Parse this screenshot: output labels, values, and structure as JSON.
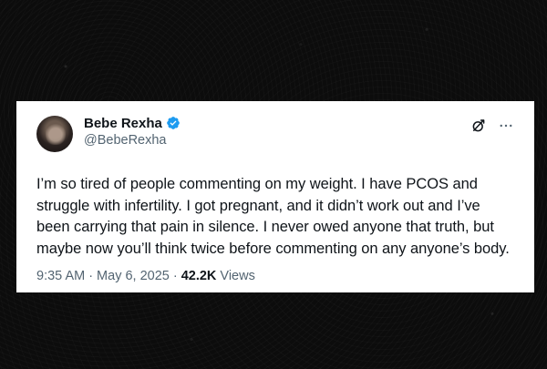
{
  "tweet": {
    "author": {
      "display_name": "Bebe Rexha",
      "handle": "@BebeRexha",
      "verified": true
    },
    "text": "I’m so tired of people commenting on my weight. I have PCOS and\nstruggle with infertility. I got pregnant, and it didn’t work out and I’ve\nbeen carrying that pain in silence. I never owed anyone that truth, but\nmaybe now you’ll think twice before commenting on any anyone’s body.",
    "time": "9:35 AM",
    "separator": "·",
    "date": "May 6, 2025",
    "views_count": "42.2K",
    "views_label": "Views"
  },
  "icons": {
    "verified": "verified-badge-icon",
    "grok": "grok-icon",
    "more": "more-options-icon"
  },
  "colors": {
    "verified_blue": "#1d9bf0",
    "text_primary": "#0f1419",
    "text_secondary": "#536471",
    "background": "#0c0c0c",
    "card": "#ffffff"
  }
}
